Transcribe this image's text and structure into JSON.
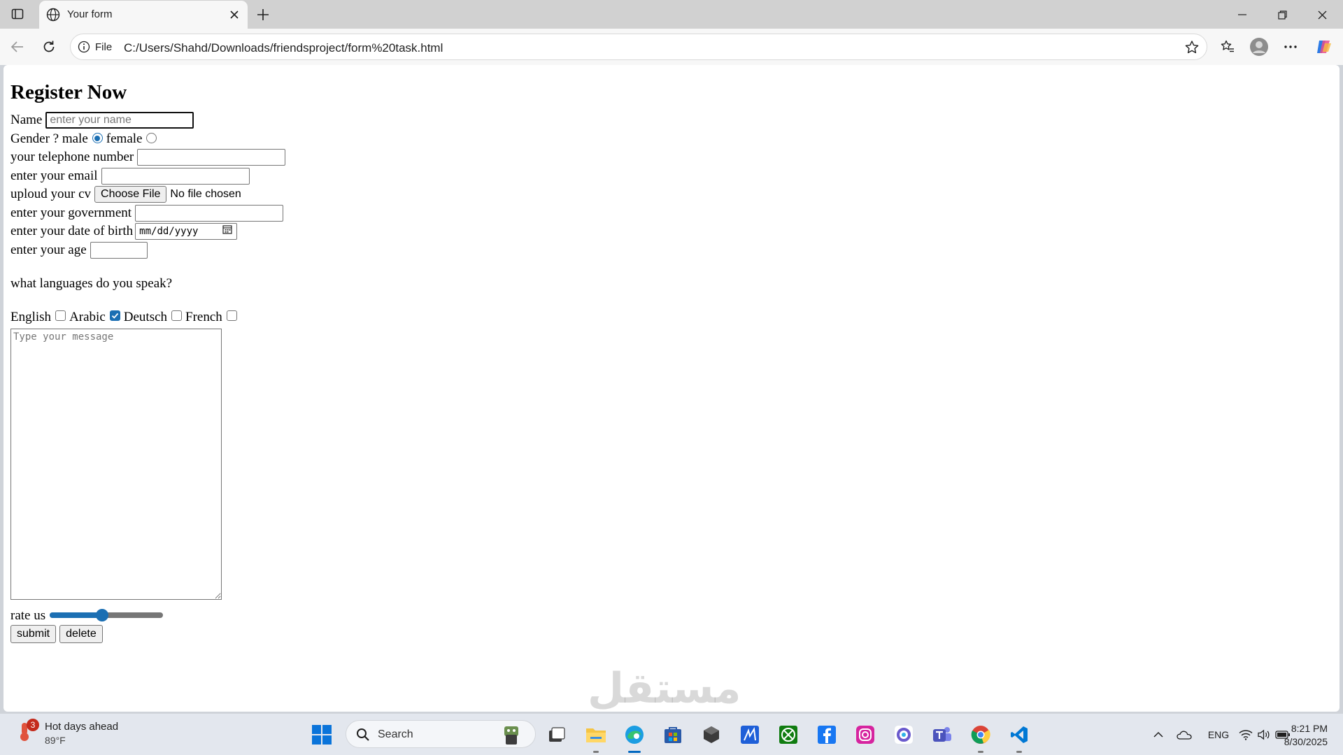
{
  "browser": {
    "tab_title": "Your form",
    "address_scheme": "File",
    "address_url": "C:/Users/Shahd/Downloads/friendsproject/form%20task.html"
  },
  "form": {
    "heading": "Register Now",
    "name_label": "Name",
    "name_placeholder": "enter your name",
    "gender_label": "Gender ? male",
    "gender_female": "female",
    "gender_selected": "male",
    "phone_label": "your telephone number",
    "email_label": "enter your email",
    "cv_label": "uploud your cv",
    "cv_button": "Choose File",
    "cv_status": "No file chosen",
    "government_label": "enter your government",
    "dob_label": "enter your date of birth",
    "dob_placeholder": "mm/dd/yyyy",
    "age_label": "enter your age",
    "languages_question": "what languages do you speak?",
    "languages": [
      {
        "label": "English",
        "checked": false
      },
      {
        "label": "Arabic",
        "checked": true
      },
      {
        "label": "Deutsch",
        "checked": false
      },
      {
        "label": "French",
        "checked": false
      }
    ],
    "message_placeholder": "Type your message",
    "rate_label": "rate us",
    "rate_value_fraction": 0.46,
    "submit_label": "submit",
    "delete_label": "delete"
  },
  "watermark": "مستقل",
  "taskbar": {
    "weather_title": "Hot days ahead",
    "weather_temp": "89°F",
    "weather_badge": "3",
    "search_label": "Search",
    "language": "ENG",
    "time": "8:21 PM",
    "date": "8/30/2025"
  },
  "colors": {
    "accent": "#1b6fb3",
    "tabbar": "#d1d1d1",
    "taskbar": "#e3e7ee"
  }
}
